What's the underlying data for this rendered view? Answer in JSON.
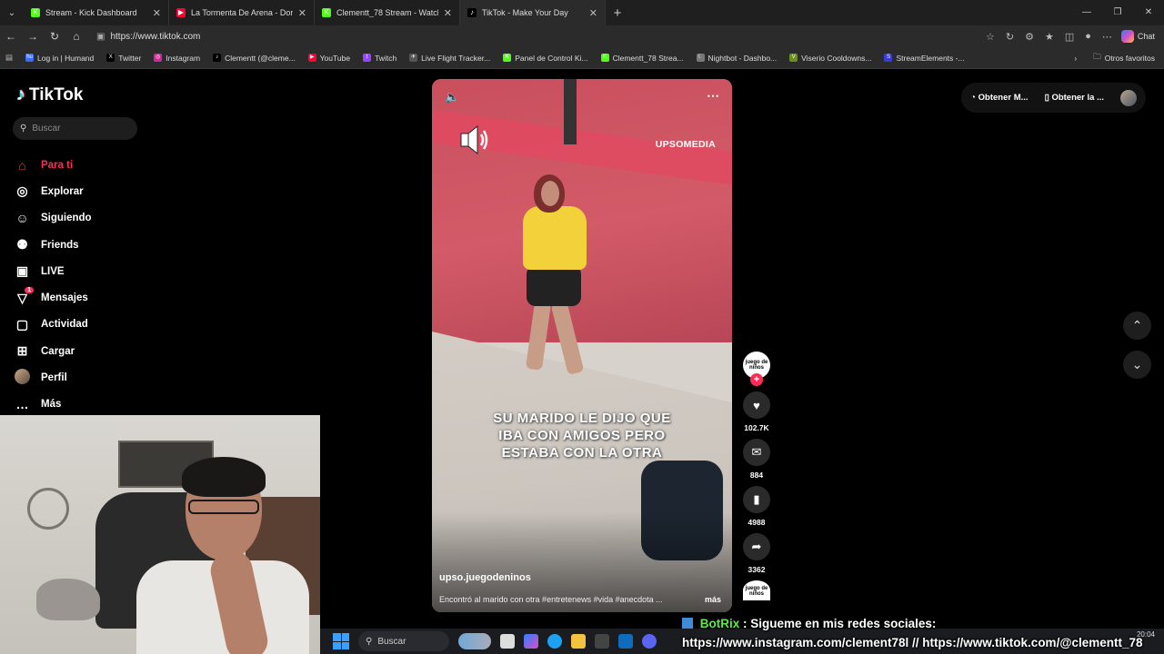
{
  "browser": {
    "tabs": [
      {
        "title": "Stream - Kick Dashboard",
        "fav_color": "#53fc18",
        "glyph": "K",
        "active": false
      },
      {
        "title": "La Tormenta De Arena - Dorian",
        "fav_color": "#ff0033",
        "glyph": "▶",
        "active": false
      },
      {
        "title": "Clementt_78 Stream - Watch Live o",
        "fav_color": "#53fc18",
        "glyph": "K",
        "active": false
      },
      {
        "title": "TikTok - Make Your Day",
        "fav_color": "#000000",
        "glyph": "♪",
        "active": true
      }
    ],
    "url": "https://www.tiktok.com",
    "chat_label": "Chat",
    "bookmarks": [
      {
        "label": "Log in | Humand",
        "color": "#3b6cf6",
        "glyph": "hu"
      },
      {
        "label": "Twitter",
        "color": "#000000",
        "glyph": "X"
      },
      {
        "label": "Instagram",
        "color": "#d6249f",
        "glyph": "◎"
      },
      {
        "label": "Clementt (@cleme...",
        "color": "#000000",
        "glyph": "♪"
      },
      {
        "label": "YouTube",
        "color": "#ff0033",
        "glyph": "▶"
      },
      {
        "label": "Twitch",
        "color": "#9146ff",
        "glyph": "t"
      },
      {
        "label": "Live Flight Tracker...",
        "color": "#555555",
        "glyph": "✈"
      },
      {
        "label": "Panel de Control Ki...",
        "color": "#53fc18",
        "glyph": "K"
      },
      {
        "label": "Clementt_78 Strea...",
        "color": "#53fc18",
        "glyph": "K"
      },
      {
        "label": "Nightbot - Dashbo...",
        "color": "#777777",
        "glyph": "☾"
      },
      {
        "label": "Viserio Cooldowns...",
        "color": "#6b8e23",
        "glyph": "V"
      },
      {
        "label": "StreamElements -...",
        "color": "#3b3bd6",
        "glyph": "S"
      }
    ],
    "other_bookmarks": "Otros favoritos"
  },
  "tiktok": {
    "logo": "TikTok",
    "search_placeholder": "Buscar",
    "nav": [
      {
        "label": "Para ti",
        "icon": "home-icon",
        "glyph": "⌂",
        "active": true,
        "badge": ""
      },
      {
        "label": "Explorar",
        "icon": "compass-icon",
        "glyph": "◎",
        "active": false,
        "badge": ""
      },
      {
        "label": "Siguiendo",
        "icon": "user-follow-icon",
        "glyph": "☺",
        "active": false,
        "badge": ""
      },
      {
        "label": "Friends",
        "icon": "friends-icon",
        "glyph": "⚉",
        "active": false,
        "badge": ""
      },
      {
        "label": "LIVE",
        "icon": "live-tv-icon",
        "glyph": "▣",
        "active": false,
        "badge": ""
      },
      {
        "label": "Mensajes",
        "icon": "messages-icon",
        "glyph": "▽",
        "active": false,
        "badge": "1"
      },
      {
        "label": "Actividad",
        "icon": "activity-icon",
        "glyph": "▢",
        "active": false,
        "badge": ""
      },
      {
        "label": "Cargar",
        "icon": "upload-icon",
        "glyph": "⊞",
        "active": false,
        "badge": ""
      },
      {
        "label": "Perfil",
        "icon": "profile-avatar",
        "glyph": "",
        "active": false,
        "badge": ""
      },
      {
        "label": "Más",
        "icon": "more-icon",
        "glyph": "…",
        "active": false,
        "badge": ""
      }
    ],
    "top_right": {
      "coins": "Obtener M...",
      "app": "Obtener la ..."
    },
    "video": {
      "brand": "UPSOMEDIA",
      "caption": "SU MARIDO LE DIJO QUE IBA CON AMIGOS PERO ESTABA CON LA OTRA",
      "author": "upso.juegodeninos",
      "description": "Encontró al marido con otra #entretenews #vida #anecdota ...",
      "more": "más"
    },
    "actions": {
      "creator_avatar_text": "juego de niños",
      "likes": "102.7K",
      "comments": "884",
      "saves": "4988",
      "shares": "3362"
    }
  },
  "taskbar": {
    "search_placeholder": "Buscar",
    "time": "20:04"
  },
  "overlay": {
    "bot_name": "BotRix",
    "line1": ": Sigueme en mis redes sociales:",
    "line2": "https://www.instagram.com/clement78l // https://www.tiktok.com/@clementt_78"
  }
}
